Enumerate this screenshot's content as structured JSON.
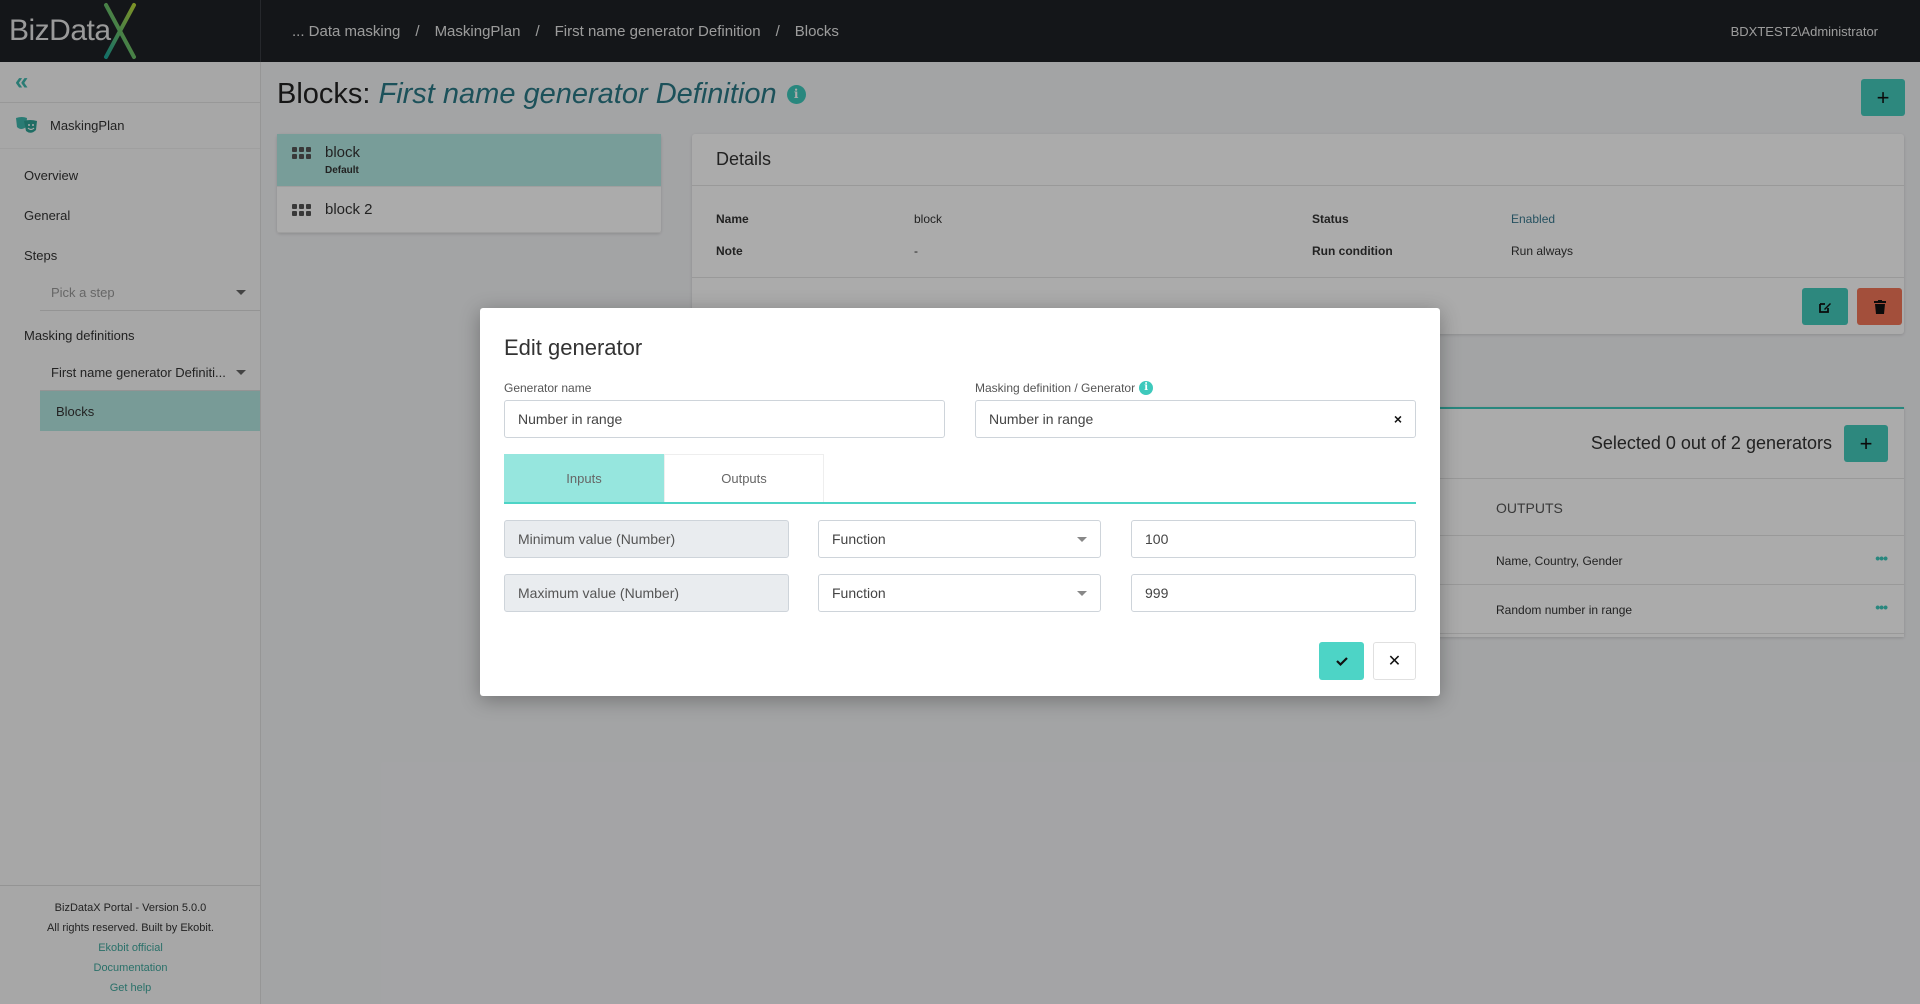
{
  "header": {
    "logo_text": "BizData",
    "breadcrumb": [
      "... Data masking",
      "MaskingPlan",
      "First name generator Definition",
      "Blocks"
    ],
    "separator": "/",
    "user": "BDXTEST2\\Administrator"
  },
  "sidebar": {
    "collapse_icon": "double-chevron-left-icon",
    "plan_name": "MaskingPlan",
    "items": [
      {
        "label": "Overview"
      },
      {
        "label": "General"
      },
      {
        "label": "Steps"
      }
    ],
    "steps_select": {
      "placeholder": "Pick a step"
    },
    "masking_definitions_label": "Masking definitions",
    "definition_select": {
      "value": "First name generator Definiti..."
    },
    "active_item": "Blocks",
    "footer": {
      "version": "BizDataX Portal - Version 5.0.0",
      "rights": "All rights reserved. Built by Ekobit.",
      "links": [
        "Ekobit official",
        "Documentation",
        "Get help"
      ]
    }
  },
  "main": {
    "title_prefix": "Blocks:",
    "title_name": "First name generator Definition",
    "add_button": "+",
    "blocks": [
      {
        "name": "block",
        "badge": "Default",
        "active": true
      },
      {
        "name": "block 2",
        "badge": "",
        "active": false
      }
    ],
    "details": {
      "heading": "Details",
      "name_label": "Name",
      "name_value": "block",
      "note_label": "Note",
      "note_value": "-",
      "status_label": "Status",
      "status_value": "Enabled",
      "run_label": "Run condition",
      "run_value": "Run always"
    },
    "generators": {
      "count_text": "Selected 0 out of 2 generators",
      "add_button": "+",
      "outputs_header": "OUTPUTS",
      "rows": [
        {
          "outputs": "Name, Country, Gender",
          "menu": "•••"
        },
        {
          "outputs": "Random number in range",
          "menu": "•••"
        }
      ]
    }
  },
  "modal": {
    "title": "Edit generator",
    "generator_name_label": "Generator name",
    "generator_name_value": "Number in range",
    "definition_label": "Masking definition / Generator",
    "definition_value": "Number in range",
    "clear_icon": "×",
    "tabs": [
      {
        "label": "Inputs",
        "active": true
      },
      {
        "label": "Outputs",
        "active": false
      }
    ],
    "inputs": [
      {
        "name": "Minimum value (Number)",
        "type": "Function",
        "value": "100"
      },
      {
        "name": "Maximum value (Number)",
        "type": "Function",
        "value": "999"
      }
    ],
    "confirm_icon": "check-icon",
    "cancel_label": "✕"
  },
  "colors": {
    "accent": "#43cbbd",
    "danger": "#f47659",
    "header_bg": "#1f2226",
    "active_tab": "#96e6de"
  }
}
